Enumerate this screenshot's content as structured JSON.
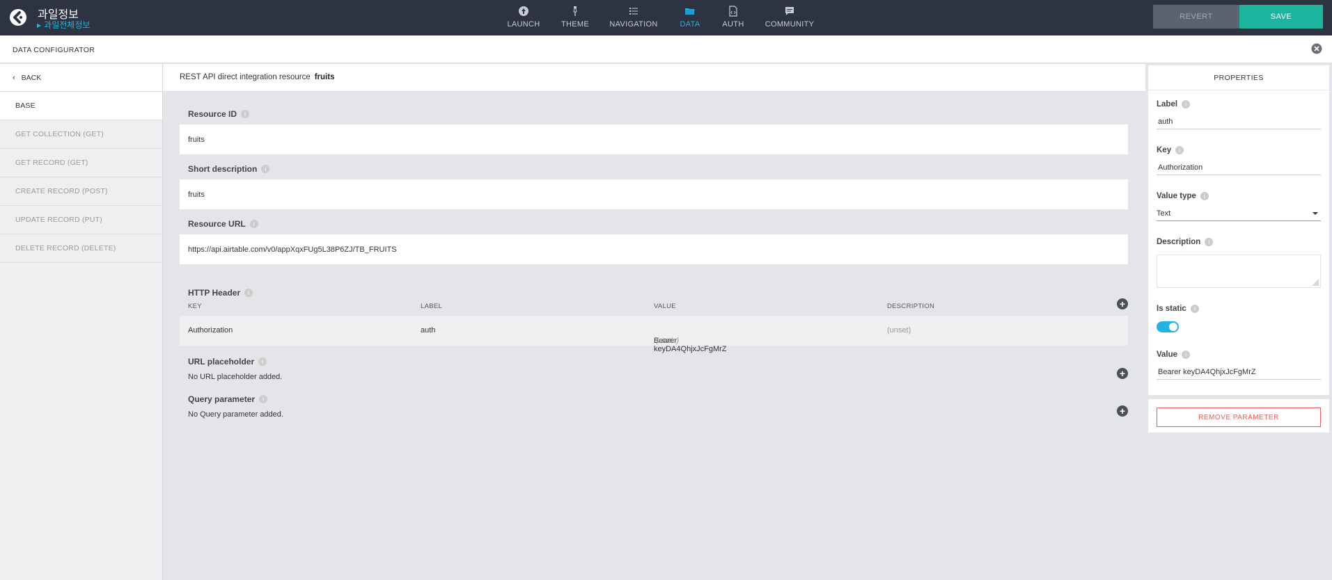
{
  "app": {
    "title": "과일정보",
    "subtitle": "과일전체정보"
  },
  "nav": [
    {
      "label": "LAUNCH",
      "icon": "launch-icon"
    },
    {
      "label": "THEME",
      "icon": "theme-icon"
    },
    {
      "label": "NAVIGATION",
      "icon": "navigation-icon"
    },
    {
      "label": "DATA",
      "icon": "data-folder-icon",
      "active": true
    },
    {
      "label": "AUTH",
      "icon": "auth-icon"
    },
    {
      "label": "COMMUNITY",
      "icon": "community-icon"
    }
  ],
  "actions": {
    "revert": "REVERT",
    "save": "SAVE"
  },
  "configurator": {
    "title": "DATA CONFIGURATOR"
  },
  "sidebar": {
    "back": "BACK",
    "items": [
      {
        "label": "BASE",
        "active": true
      },
      {
        "label": "GET COLLECTION (GET)"
      },
      {
        "label": "GET RECORD (GET)"
      },
      {
        "label": "CREATE RECORD (POST)"
      },
      {
        "label": "UPDATE RECORD (PUT)"
      },
      {
        "label": "DELETE RECORD (DELETE)"
      }
    ]
  },
  "main": {
    "header_text": "REST API direct integration resource",
    "resource_name": "fruits",
    "resource_id_label": "Resource ID",
    "resource_id": "fruits",
    "short_desc_label": "Short description",
    "short_desc": "fruits",
    "resource_url_label": "Resource URL",
    "resource_url": "https://api.airtable.com/v0/appXqxFUg5L38P6ZJ/TB_FRUITS",
    "http_header": {
      "title": "HTTP Header",
      "columns": [
        "KEY",
        "LABEL",
        "VALUE",
        "DESCRIPTION"
      ],
      "rows": [
        {
          "key": "Authorization",
          "label": "auth",
          "value": "Bearer keyDA4QhjxJcFgMrZ",
          "static": "(static)",
          "description": "(unset)"
        }
      ]
    },
    "url_placeholder": {
      "title": "URL placeholder",
      "empty": "No URL placeholder added."
    },
    "query_parameter": {
      "title": "Query parameter",
      "empty": "No Query parameter added."
    }
  },
  "properties": {
    "title": "PROPERTIES",
    "label_label": "Label",
    "label_value": "auth",
    "key_label": "Key",
    "key_value": "Authorization",
    "value_type_label": "Value type",
    "value_type": "Text",
    "description_label": "Description",
    "is_static_label": "Is static",
    "is_static": true,
    "value_label": "Value",
    "value": "Bearer keyDA4QhjxJcFgMrZ",
    "remove": "REMOVE PARAMETER"
  },
  "colors": {
    "topbar": "#2d3340",
    "accent": "#23b2e6",
    "save": "#1bb59e",
    "danger": "#f05a5a"
  }
}
